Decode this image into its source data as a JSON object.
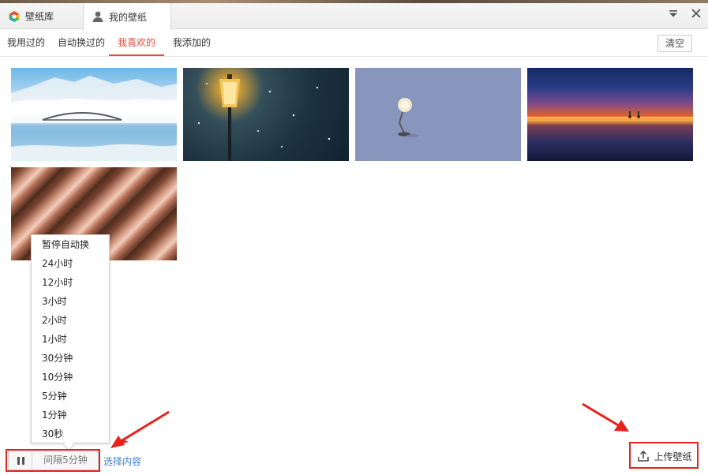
{
  "titlebar": {
    "tab_library": "壁纸库",
    "tab_mine": "我的壁纸"
  },
  "subnav": {
    "tabs": [
      "我用过的",
      "自动换过的",
      "我喜欢的",
      "我添加的"
    ],
    "active_index": 2,
    "clear_label": "清空"
  },
  "thumbnails": [
    {
      "subject": "snowy-bridge-lake"
    },
    {
      "subject": "street-lamp-snow"
    },
    {
      "subject": "desk-lamp-purple"
    },
    {
      "subject": "sunset-cyclists"
    },
    {
      "subject": "diagonal-stripes"
    }
  ],
  "interval_menu": {
    "items": [
      "暂停自动换",
      "24小时",
      "12小时",
      "3小时",
      "2小时",
      "1小时",
      "30分钟",
      "10分钟",
      "5分钟",
      "1分钟",
      "30秒"
    ]
  },
  "bottom": {
    "interval_label": "间隔5分钟",
    "select_content_label": "选择内容",
    "upload_label": "上传壁纸"
  },
  "colors": {
    "accent_active_tab": "#e74c3c",
    "link": "#3a7fd5",
    "annotation_red": "#e8221b"
  }
}
